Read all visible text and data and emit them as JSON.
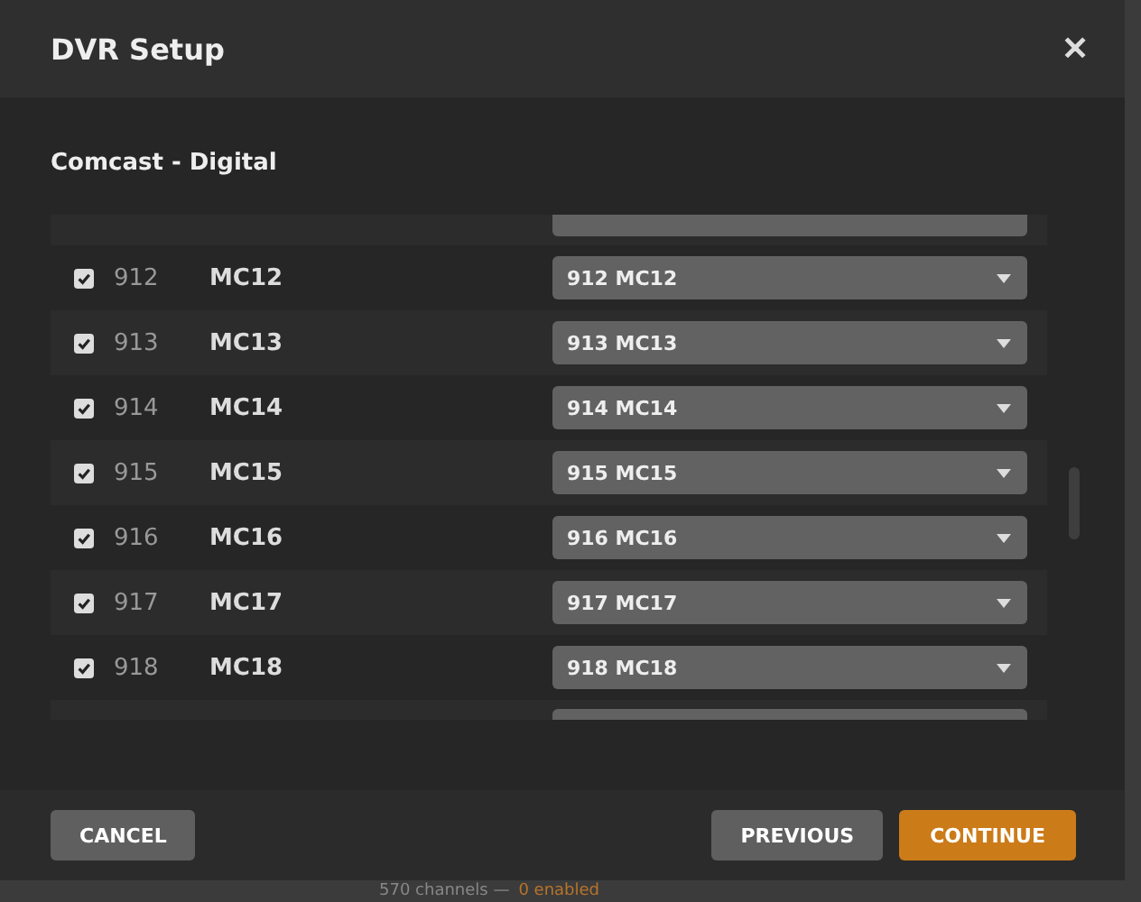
{
  "dialog": {
    "title": "DVR Setup",
    "close": "✕",
    "subtitle": "Comcast - Digital"
  },
  "channels": [
    {
      "number": "912",
      "name": "MC12",
      "checked": true,
      "mapping": "912 MC12"
    },
    {
      "number": "913",
      "name": "MC13",
      "checked": true,
      "mapping": "913 MC13"
    },
    {
      "number": "914",
      "name": "MC14",
      "checked": true,
      "mapping": "914 MC14"
    },
    {
      "number": "915",
      "name": "MC15",
      "checked": true,
      "mapping": "915 MC15"
    },
    {
      "number": "916",
      "name": "MC16",
      "checked": true,
      "mapping": "916 MC16"
    },
    {
      "number": "917",
      "name": "MC17",
      "checked": true,
      "mapping": "917 MC17"
    },
    {
      "number": "918",
      "name": "MC18",
      "checked": true,
      "mapping": "918 MC18"
    }
  ],
  "buttons": [
    {
      "label": "CANCEL",
      "kind": "secondary"
    },
    {
      "label": "PREVIOUS",
      "kind": "secondary"
    },
    {
      "label": "CONTINUE",
      "kind": "primary"
    }
  ],
  "status": {
    "count": "570 channels —",
    "enabled": "0 enabled"
  }
}
